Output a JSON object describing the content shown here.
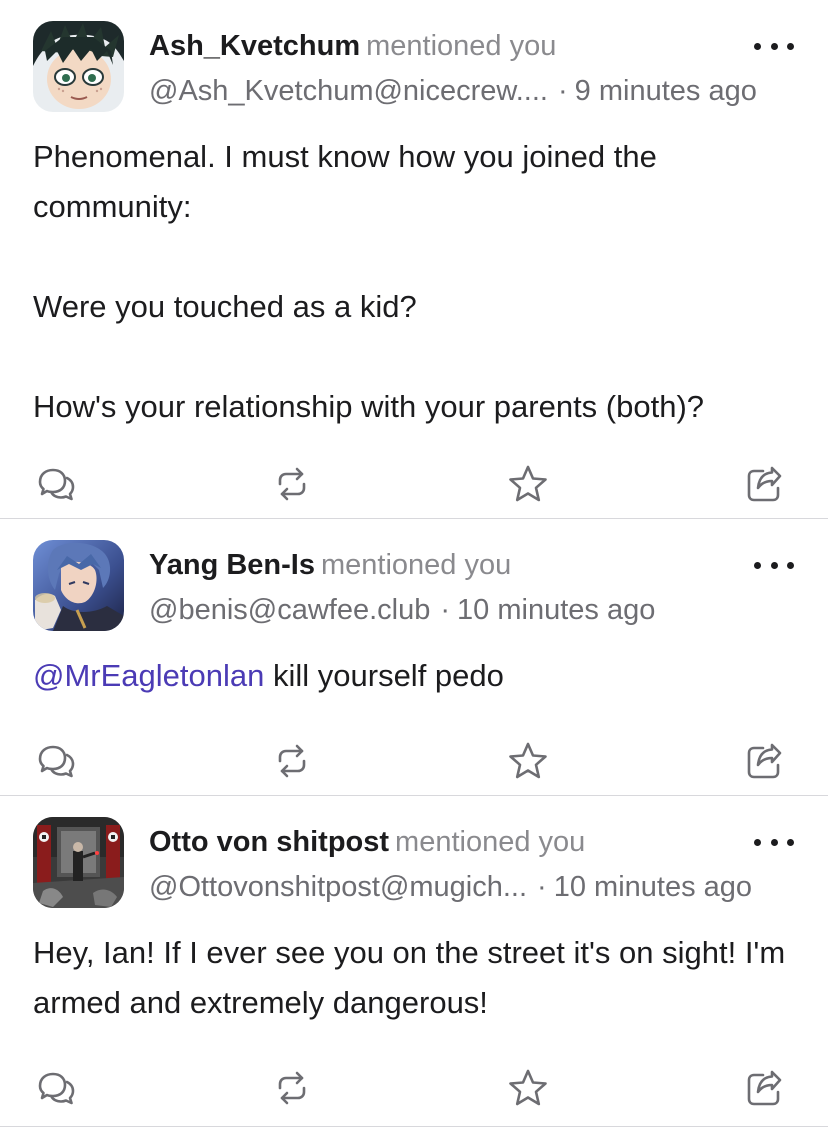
{
  "posts": [
    {
      "display_name": "Ash_Kvetchum",
      "action": "mentioned you",
      "handle": "@Ash_Kvetchum@nicecrew....",
      "separator": "·",
      "time": "9 minutes ago",
      "content": [
        "Phenomenal. I must know how you joined the community:",
        "Were you touched as a kid?",
        "How's your relationship with your parents (both)?"
      ]
    },
    {
      "display_name": "Yang Ben-Is",
      "action": "mentioned you",
      "handle": "@benis@cawfee.club",
      "separator": "·",
      "time": "10 minutes ago",
      "mention": "@MrEagletonlan",
      "content_after_mention": " kill yourself pedo"
    },
    {
      "display_name": "Otto von shitpost",
      "action": "mentioned you",
      "handle": "@Ottovonshitpost@mugich...",
      "separator": "·",
      "time": "10 minutes ago",
      "content": [
        "Hey, Ian! If I ever see you on the street it's on sight! I'm armed and extremely dangerous!"
      ]
    }
  ],
  "icons": {
    "more": "more-horizontal-icon",
    "reply": "reply-bubble-icon",
    "boost": "boost-repeat-icon",
    "favourite": "star-icon",
    "share": "share-icon"
  },
  "colors": {
    "mention_link": "#4b3bb5",
    "muted_text": "#8a8a8e",
    "divider": "#d8d8dc"
  }
}
